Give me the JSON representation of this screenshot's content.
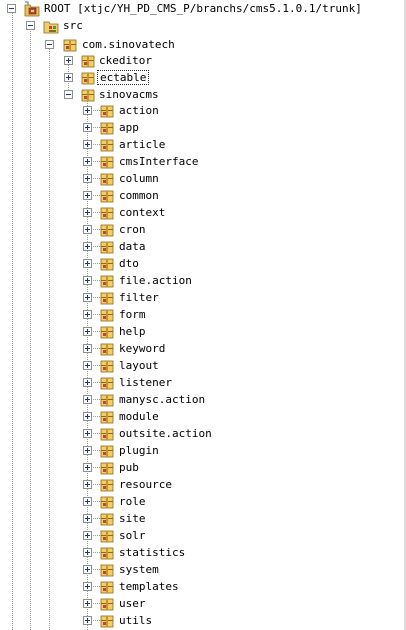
{
  "tree": {
    "root": {
      "label": "ROOT [xtjc/YH_PD_CMS_P/branchs/cms5.1.0.1/trunk]"
    },
    "src": {
      "label": "src"
    },
    "pkg": {
      "label": "com.sinovatech"
    },
    "ckeditor": {
      "label": "ckeditor"
    },
    "ectable": {
      "label": "ectable"
    },
    "sinovacms": {
      "label": "sinovacms"
    },
    "children": [
      {
        "label": "action"
      },
      {
        "label": "app"
      },
      {
        "label": "article"
      },
      {
        "label": "cmsInterface"
      },
      {
        "label": "column"
      },
      {
        "label": "common"
      },
      {
        "label": "context"
      },
      {
        "label": "cron"
      },
      {
        "label": "data"
      },
      {
        "label": "dto"
      },
      {
        "label": "file.action"
      },
      {
        "label": "filter"
      },
      {
        "label": "form"
      },
      {
        "label": "help"
      },
      {
        "label": "keyword"
      },
      {
        "label": "layout"
      },
      {
        "label": "listener"
      },
      {
        "label": "manysc.action"
      },
      {
        "label": "module"
      },
      {
        "label": "outsite.action"
      },
      {
        "label": "plugin"
      },
      {
        "label": "pub"
      },
      {
        "label": "resource"
      },
      {
        "label": "role"
      },
      {
        "label": "site"
      },
      {
        "label": "solr"
      },
      {
        "label": "statistics"
      },
      {
        "label": "system"
      },
      {
        "label": "templates"
      },
      {
        "label": "user"
      },
      {
        "label": "utils"
      }
    ]
  }
}
